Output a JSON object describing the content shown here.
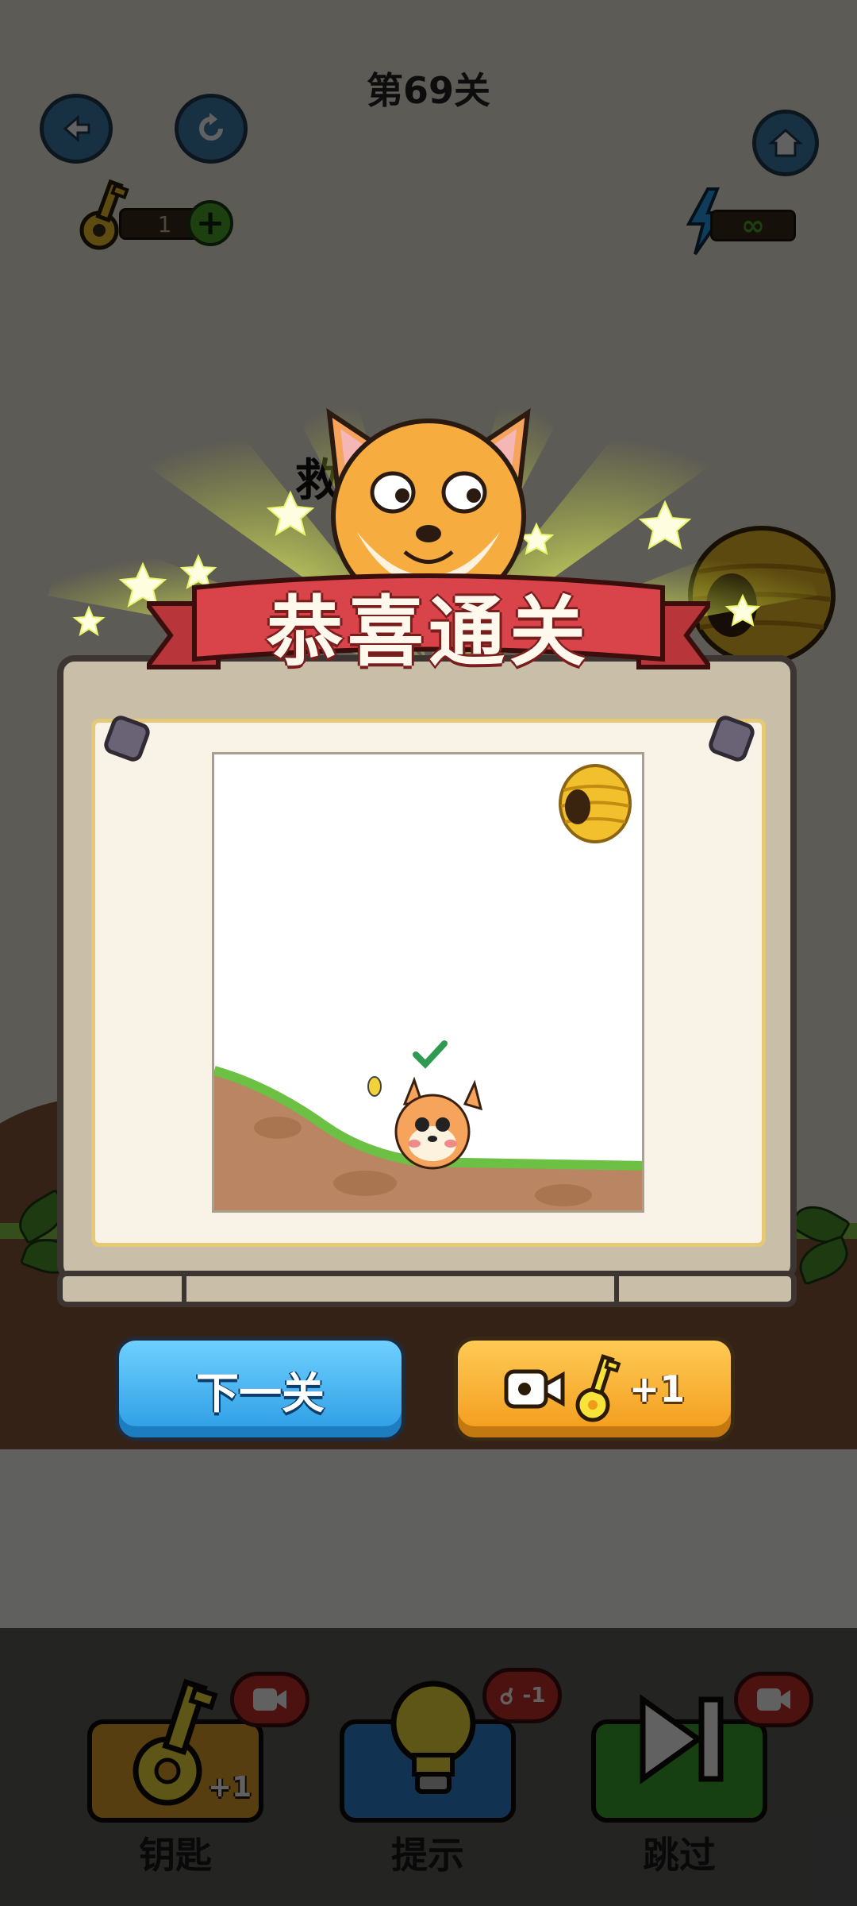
{
  "hud": {
    "level_title": "第69关",
    "key_count": "1",
    "energy_value": "∞"
  },
  "objective_text": "救",
  "celebration": {
    "banner_text": "恭喜通关"
  },
  "buttons": {
    "next_level": "下一关",
    "video_key_reward": "+1"
  },
  "tools": [
    {
      "label": "钥匙",
      "badge": "+1",
      "bubble_text": ""
    },
    {
      "label": "提示",
      "badge": "",
      "bubble_text": "-1"
    },
    {
      "label": "跳过",
      "badge": "",
      "bubble_text": ""
    }
  ],
  "icons": {
    "back": "back-arrow-icon",
    "restart": "restart-icon",
    "home": "home-icon",
    "key": "key-icon",
    "energy": "lightning-icon",
    "video": "video-camera-icon",
    "hint": "lightbulb-icon",
    "skip": "skip-icon"
  },
  "colors": {
    "next_button": "#2a9be3",
    "video_button": "#f29b1b",
    "banner_red": "#d9444a",
    "key_tool": "#e3a32c",
    "hint_tool": "#2f86d6",
    "skip_tool": "#3ca82e"
  }
}
